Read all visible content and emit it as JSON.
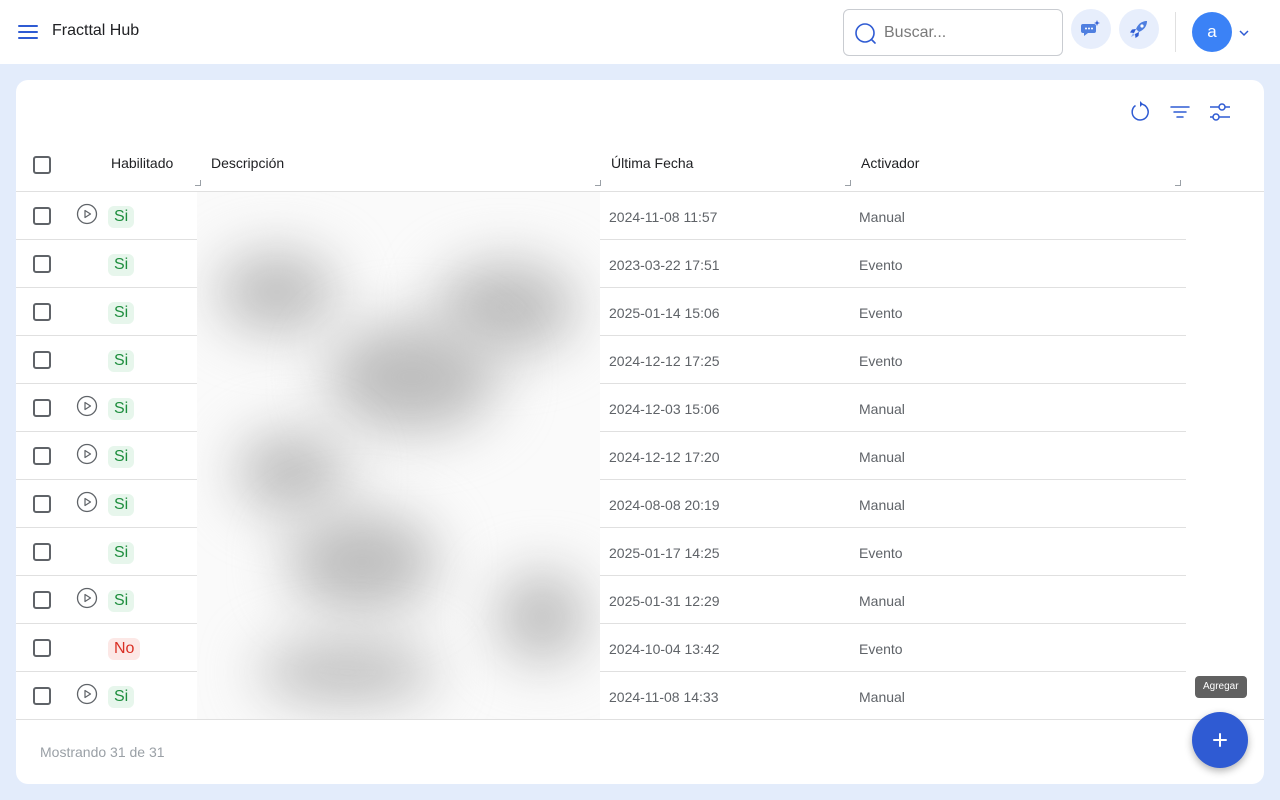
{
  "app": {
    "title": "Fracttal Hub"
  },
  "search": {
    "placeholder": "Buscar..."
  },
  "user": {
    "avatar_letter": "a"
  },
  "table": {
    "columns": [
      "Habilitado",
      "Descripción",
      "Última Fecha",
      "Activador"
    ],
    "rows": [
      {
        "play": true,
        "enabled": "Si",
        "date": "2024-11-08 11:57",
        "trigger": "Manual"
      },
      {
        "play": false,
        "enabled": "Si",
        "date": "2023-03-22 17:51",
        "trigger": "Evento"
      },
      {
        "play": false,
        "enabled": "Si",
        "date": "2025-01-14 15:06",
        "trigger": "Evento"
      },
      {
        "play": false,
        "enabled": "Si",
        "date": "2024-12-12 17:25",
        "trigger": "Evento"
      },
      {
        "play": true,
        "enabled": "Si",
        "date": "2024-12-03 15:06",
        "trigger": "Manual"
      },
      {
        "play": true,
        "enabled": "Si",
        "date": "2024-12-12 17:20",
        "trigger": "Manual"
      },
      {
        "play": true,
        "enabled": "Si",
        "date": "2024-08-08 20:19",
        "trigger": "Manual"
      },
      {
        "play": false,
        "enabled": "Si",
        "date": "2025-01-17 14:25",
        "trigger": "Evento"
      },
      {
        "play": true,
        "enabled": "Si",
        "date": "2025-01-31 12:29",
        "trigger": "Manual"
      },
      {
        "play": false,
        "enabled": "No",
        "date": "2024-10-04 13:42",
        "trigger": "Evento"
      },
      {
        "play": true,
        "enabled": "Si",
        "date": "2024-11-08 14:33",
        "trigger": "Manual"
      }
    ]
  },
  "footer": {
    "summary": "Mostrando 31 de 31"
  },
  "fab": {
    "tooltip": "Agregar"
  },
  "icons": {
    "menu": "menu-icon",
    "search": "search-icon",
    "chat": "chat-sparkle-icon",
    "rocket": "rocket-icon",
    "caret": "chevron-down-icon",
    "refresh": "refresh-icon",
    "filter": "filter-icon",
    "settings": "sliders-icon",
    "play": "play-circle-icon",
    "add": "plus-icon"
  },
  "colors": {
    "accent": "#2f5bd3",
    "enabled": "#1e8e3e",
    "disabled": "#d93025",
    "background": "#e3ecfb"
  }
}
